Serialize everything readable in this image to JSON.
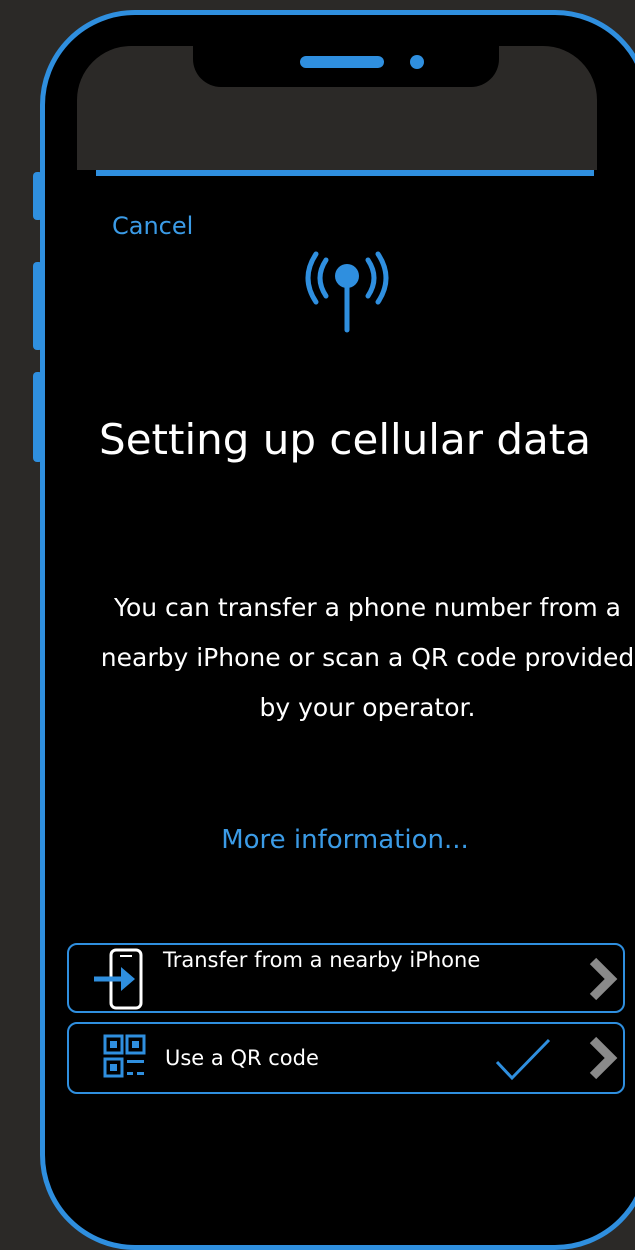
{
  "header": {
    "cancel_label": "Cancel"
  },
  "hero": {
    "icon": "cellular-antenna-icon",
    "title": "Setting up cellular data",
    "description": "You can transfer a phone number from a nearby iPhone or scan a QR code provided by your operator.",
    "more_link": "More information..."
  },
  "options": [
    {
      "label": "Transfer from a nearby iPhone",
      "icon": "phone-transfer-icon",
      "selected": false
    },
    {
      "label": "Use a QR code",
      "icon": "qr-code-icon",
      "selected": true
    }
  ],
  "colors": {
    "accent": "#2f8fdf",
    "link": "#3b9be6",
    "background": "#2b2927",
    "screen": "#000000",
    "chevron": "#8a8a8a"
  }
}
